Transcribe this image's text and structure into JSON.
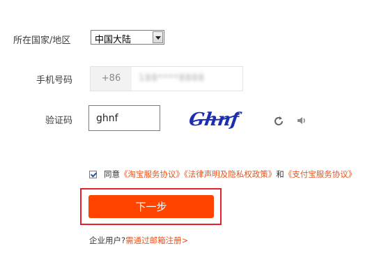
{
  "form": {
    "country_label": "所在国家/地区",
    "country_value": "中国大陆",
    "phone_label": "手机号码",
    "phone_prefix": "+86",
    "phone_value": "188****8888",
    "captcha_label": "验证码",
    "captcha_value": "ghnf",
    "captcha_image_text": "Ghnf"
  },
  "agreement": {
    "prefix": "同意",
    "link1": "《淘宝服务协议》",
    "link2": "《法律声明及隐私权政策》",
    "and": "和",
    "link3": "《支付宝服务协议》",
    "checked": true
  },
  "next_button_label": "下一步",
  "enterprise": {
    "prefix": "企业用户?",
    "link": "需通过邮箱注册>"
  },
  "colors": {
    "accent": "#ff4400",
    "link": "#e8541d",
    "highlight_frame": "#e4202a",
    "captcha_text": "#1c2fb0"
  },
  "icons": {
    "refresh": "refresh-icon",
    "sound": "speaker-icon",
    "dropdown": "chevron-down-icon"
  }
}
